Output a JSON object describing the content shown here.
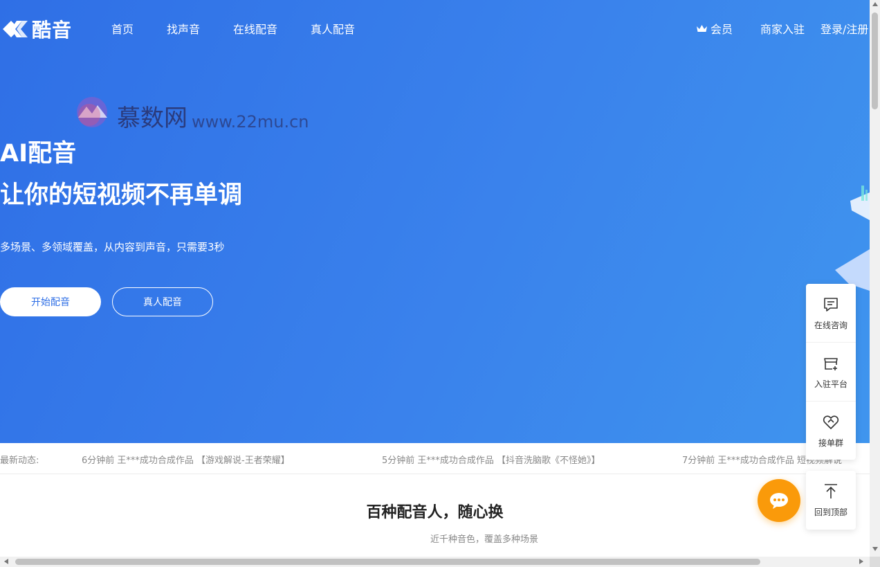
{
  "nav": {
    "brand": "酷音",
    "links": [
      "首页",
      "找声音",
      "在线配音",
      "真人配音"
    ],
    "vip": "会员",
    "merchant": "商家入驻",
    "login": "登录/注册"
  },
  "hero": {
    "title1": "AI配音",
    "title2": "让你的短视频不再单调",
    "subtitle": "多场景、多领域覆盖，从内容到声音，只需要3秒",
    "primary_button": "开始配音",
    "secondary_button": "真人配音"
  },
  "watermark": {
    "name": "慕数网",
    "url": "www.22mu.cn"
  },
  "ticker": {
    "label": "最新动态:",
    "items": [
      "6分钟前 王***成功合成作品 【游戏解说-王者荣耀】",
      "5分钟前 王***成功合成作品 【抖音洗脑歌《不怪她》】",
      "7分钟前 王***成功合成作品 短视频解说"
    ]
  },
  "section": {
    "title": "百种配音人，随心换",
    "subtitle": "近千种音色，覆盖多种场景"
  },
  "side_panel": {
    "items": [
      {
        "label": "在线咨询",
        "icon": "chat-icon"
      },
      {
        "label": "入驻平台",
        "icon": "store-add-icon"
      },
      {
        "label": "接单群",
        "icon": "handshake-icon"
      }
    ],
    "back_top": "回到顶部"
  },
  "colors": {
    "hero_start": "#2f6fe6",
    "hero_end": "#3f95ee",
    "fab": "#fa9a0a",
    "text_primary": "#222222",
    "text_muted": "#888888"
  }
}
